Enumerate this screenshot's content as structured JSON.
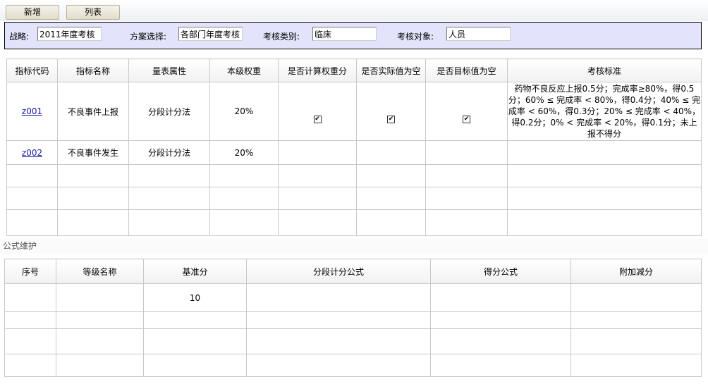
{
  "toolbar": {
    "add_label": "新增",
    "list_label": "列表"
  },
  "filters": {
    "strategy": {
      "label": "战略:",
      "value": "2011年度考核"
    },
    "plan": {
      "label": "方案选择:",
      "value": "各部门年度考核"
    },
    "category": {
      "label": "考核类别:",
      "value": "临床"
    },
    "target": {
      "label": "考核对象:",
      "value": "人员"
    }
  },
  "indicator_table": {
    "headers": [
      "指标代码",
      "指标名称",
      "量表属性",
      "本级权重",
      "是否计算权重分",
      "是否实际值为空",
      "是否目标值为空",
      "考核标准"
    ],
    "rows": [
      {
        "code": "z001",
        "name": "不良事件上报",
        "attr": "分段计分法",
        "weight": "20%",
        "calc_weight": true,
        "actual_empty": true,
        "target_empty": true,
        "standard": "药物不良反应上报0.5分；完成率≥80%，得0.5分；60% ≤ 完成率 < 80%，得0.4分；40% ≤ 完成率 < 60%，得0.3分；20% ≤ 完成率 < 40%，得0.2分；0% < 完成率 < 20%，得0.1分；未上报不得分"
      },
      {
        "code": "z002",
        "name": "不良事件发生",
        "attr": "分段计分法",
        "weight": "20%",
        "calc_weight": false,
        "actual_empty": false,
        "target_empty": false,
        "standard": ""
      }
    ]
  },
  "formula_section": {
    "title": "公式维护"
  },
  "formula_table": {
    "headers": [
      "序号",
      "等级名称",
      "基准分",
      "分段计分公式",
      "得分公式",
      "附加减分"
    ],
    "rows": [
      {
        "index": "",
        "level": "",
        "base": "10",
        "segment_formula": "",
        "score_formula": "",
        "extra": ""
      }
    ]
  }
}
